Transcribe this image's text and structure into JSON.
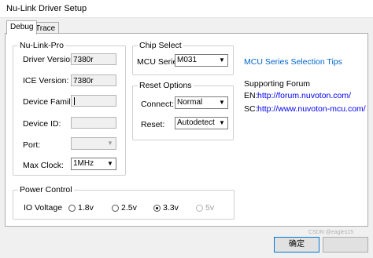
{
  "window": {
    "title": "Nu-Link Driver Setup"
  },
  "tabs": [
    {
      "label": "Debug",
      "active": true
    },
    {
      "label": "Trace",
      "active": false
    }
  ],
  "nulink": {
    "legend": "Nu-Link-Pro",
    "driver_version_label": "Driver Version:",
    "driver_version": "7380r",
    "ice_version_label": "ICE Version:",
    "ice_version": "7380r",
    "device_family_label": "Device Family:",
    "device_family": "",
    "device_id_label": "Device ID:",
    "device_id": "",
    "port_label": "Port:",
    "port": "",
    "max_clock_label": "Max Clock:",
    "max_clock": "1MHz"
  },
  "chip_select": {
    "legend": "Chip Select",
    "mcu_series_label": "MCU Series:",
    "mcu_series": "M031"
  },
  "reset_options": {
    "legend": "Reset Options",
    "connect_label": "Connect:",
    "connect": "Normal",
    "reset_label": "Reset:",
    "reset": "Autodetect"
  },
  "links": {
    "mcu_series_tips": "MCU Series Selection Tips",
    "supporting_forum": "Supporting Forum",
    "en_label": "EN:",
    "en_url": "http://forum.nuvoton.com/",
    "sc_label": "SC:",
    "sc_url": "http://www.nuvoton-mcu.com/"
  },
  "power_control": {
    "legend": "Power Control",
    "io_voltage_label": "IO Voltage",
    "options": [
      {
        "label": "1.8v",
        "checked": false,
        "enabled": true
      },
      {
        "label": "2.5v",
        "checked": false,
        "enabled": true
      },
      {
        "label": "3.3v",
        "checked": true,
        "enabled": true
      },
      {
        "label": "5v",
        "checked": false,
        "enabled": false
      }
    ]
  },
  "buttons": {
    "ok": "确定",
    "cancel": ""
  },
  "watermark": "CSDN @eagle115"
}
